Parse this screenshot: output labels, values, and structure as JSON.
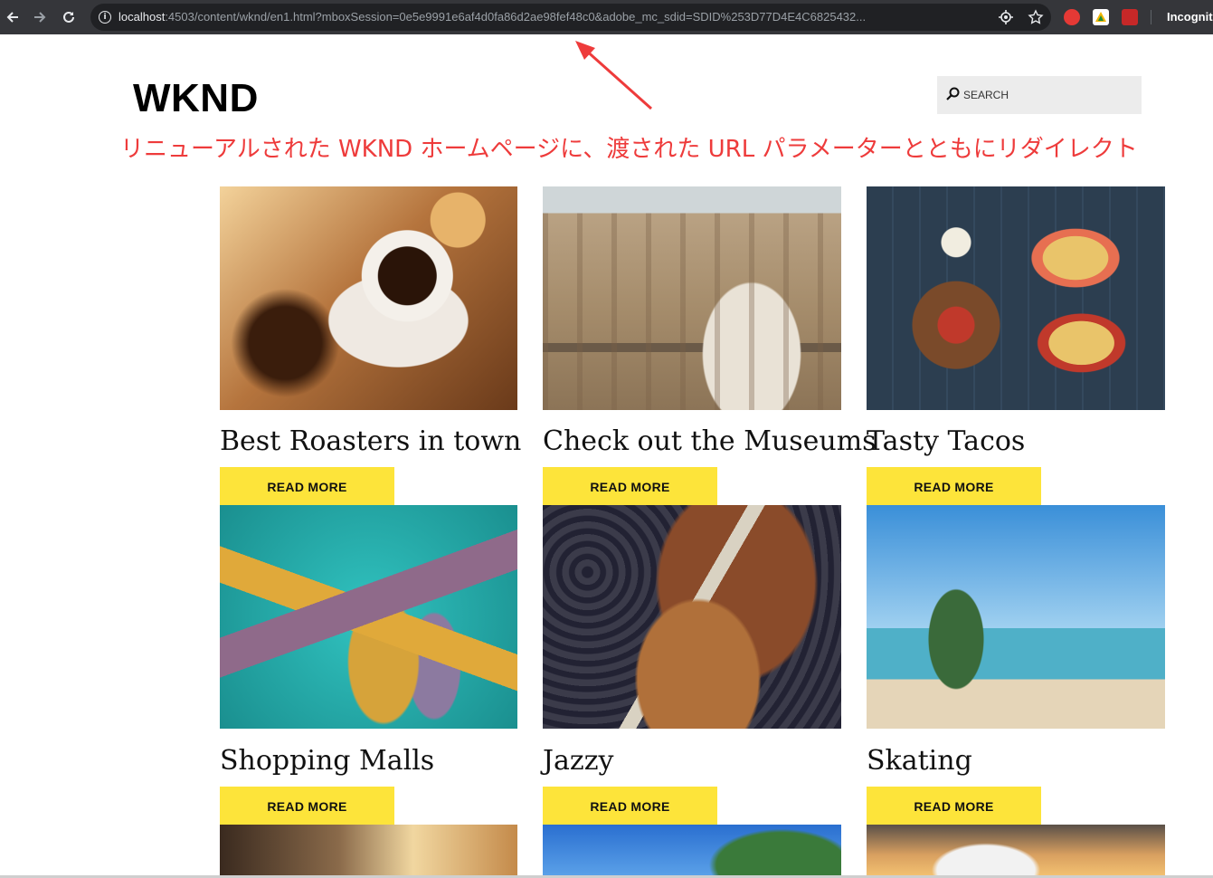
{
  "browser": {
    "url_host": "localhost",
    "url_rest": ":4503/content/wknd/en1.html?mboxSession=0e5e9991e6af4d0fa86d2ae98fef48c0&adobe_mc_sdid=SDID%253D77D4E4C6825432...",
    "profile_label": "Incognit"
  },
  "header": {
    "logo": "WKND",
    "search_placeholder": "SEARCH"
  },
  "annotation": {
    "text": "リニューアルされた WKND ホームページに、渡された URL パラメーターとともにリダイレクト",
    "color": "#ee3b3b"
  },
  "cards": [
    {
      "title": "Best Roasters in town",
      "button": "READ MORE",
      "image": "coffee-photo"
    },
    {
      "title": "Check out the Museums",
      "button": "READ MORE",
      "image": "museum-photo"
    },
    {
      "title": "Tasty Tacos",
      "button": "READ MORE",
      "image": "tacos-photo"
    },
    {
      "title": "Shopping Malls",
      "button": "READ MORE",
      "image": "shopping-photo"
    },
    {
      "title": "Jazzy",
      "button": "READ MORE",
      "image": "guitar-photo"
    },
    {
      "title": "Skating",
      "button": "READ MORE",
      "image": "beach-photo"
    }
  ],
  "colors": {
    "button_yellow": "#fde43a",
    "browser_bar": "#35363a"
  }
}
